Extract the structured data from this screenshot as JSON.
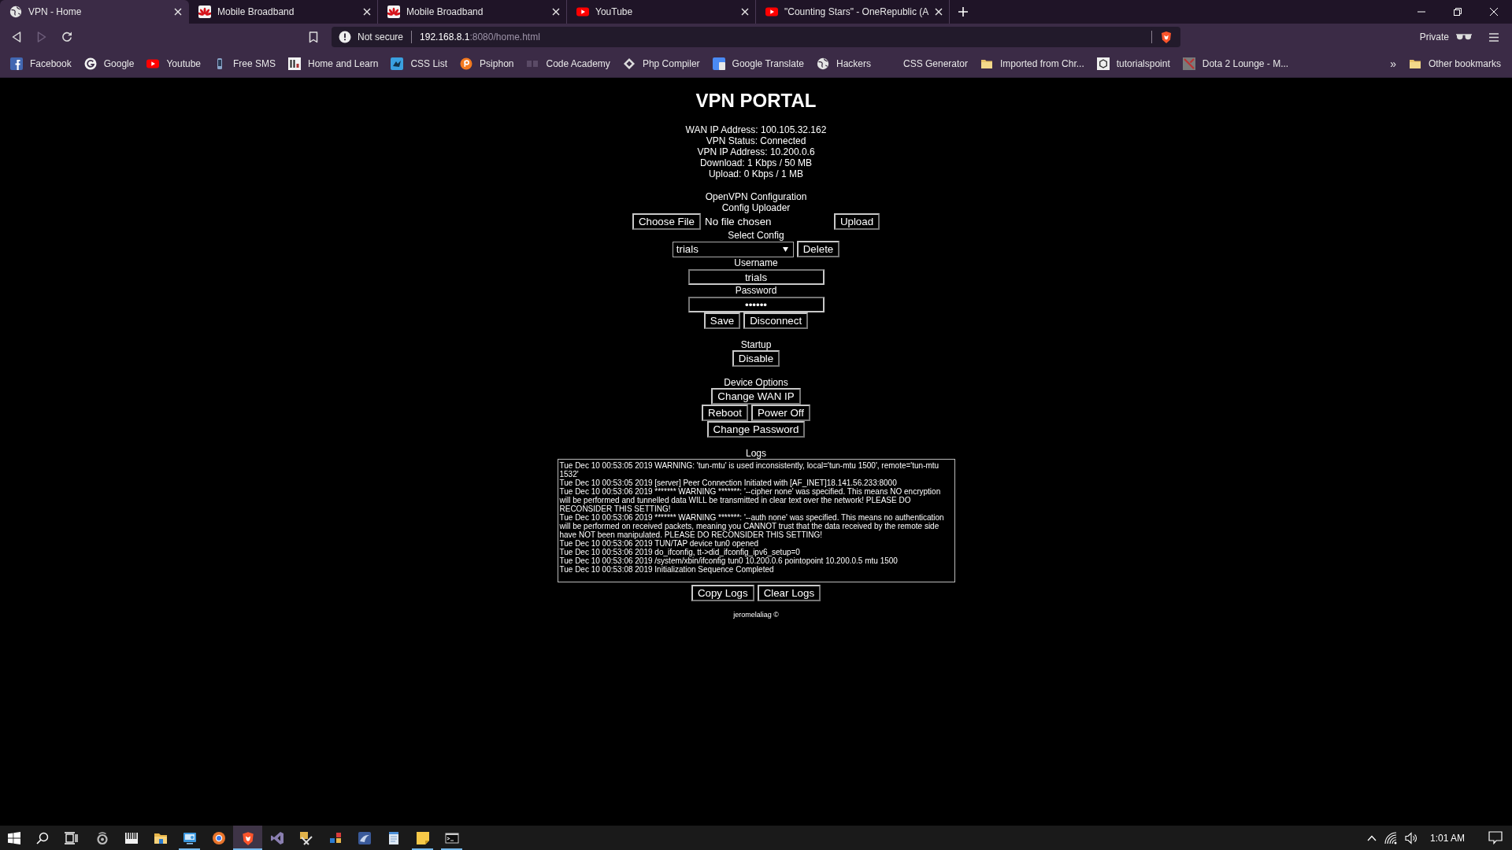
{
  "browser": {
    "tabs": [
      {
        "title": "VPN - Home",
        "selected": true
      },
      {
        "title": "Mobile Broadband",
        "selected": false
      },
      {
        "title": "Mobile Broadband",
        "selected": false
      },
      {
        "title": "YouTube",
        "selected": false
      },
      {
        "title": "\"Counting Stars\" - OneRepublic (A",
        "selected": false
      }
    ],
    "navigation": {
      "back_disabled": false,
      "forward_disabled": true
    },
    "address": {
      "security": "Not secure",
      "host": "192.168.8.1",
      "path": ":8080/home.html"
    },
    "profile": "Private",
    "bookmarks": [
      {
        "label": "Facebook"
      },
      {
        "label": "Google"
      },
      {
        "label": "Youtube"
      },
      {
        "label": "Free SMS"
      },
      {
        "label": "Home and Learn"
      },
      {
        "label": "CSS List"
      },
      {
        "label": "Psiphon"
      },
      {
        "label": "Code Academy"
      },
      {
        "label": "Php Compiler"
      },
      {
        "label": "Google Translate"
      },
      {
        "label": "Hackers"
      },
      {
        "label": "CSS Generator"
      },
      {
        "label": "Imported from Chr..."
      },
      {
        "label": "tutorialspoint"
      },
      {
        "label": "Dota 2 Lounge - M..."
      }
    ],
    "bookmarks_overflow": "»",
    "other_bookmarks": "Other bookmarks"
  },
  "page": {
    "title": "VPN PORTAL",
    "status_lines": [
      "WAN IP Address: 100.105.32.162",
      "VPN Status: Connected",
      "VPN IP Address: 10.200.0.6",
      "Download: 1 Kbps / 50 MB",
      "Upload: 0 Kbps / 1 MB"
    ],
    "config": {
      "heading": "OpenVPN Configuration",
      "subheading": "Config Uploader",
      "choose_button": "Choose File",
      "file_status": "No file chosen",
      "upload_button": "Upload",
      "select_label": "Select Config",
      "selected_config": "trials",
      "delete_button": "Delete",
      "username_label": "Username",
      "username": "trials",
      "password_label": "Password",
      "password": "••••••",
      "buttons": [
        "Save",
        "Disconnect"
      ]
    },
    "startup": {
      "label": "Startup",
      "button": "Disable"
    },
    "device_options": {
      "label": "Device Options",
      "rows": [
        [
          "Change WAN IP"
        ],
        [
          "Reboot",
          "Power Off"
        ],
        [
          "Change Password"
        ]
      ]
    },
    "logs": {
      "label": "Logs",
      "lines": [
        "Tue Dec 10 00:53:05 2019 WARNING: 'tun-mtu' is used inconsistently, local='tun-mtu 1500', remote='tun-mtu 1532'",
        "Tue Dec 10 00:53:05 2019 [server] Peer Connection Initiated with [AF_INET]18.141.56.233:8000",
        "Tue Dec 10 00:53:06 2019 ******* WARNING *******: '--cipher none' was specified. This means NO encryption will be performed and tunnelled data WILL be transmitted in clear text over the network! PLEASE DO RECONSIDER THIS SETTING!",
        "Tue Dec 10 00:53:06 2019 ******* WARNING *******: '--auth none' was specified. This means no authentication will be performed on received packets, meaning you CANNOT trust that the data received by the remote side have NOT been manipulated. PLEASE DO RECONSIDER THIS SETTING!",
        "Tue Dec 10 00:53:06 2019 TUN/TAP device tun0 opened",
        "Tue Dec 10 00:53:06 2019 do_ifconfig, tt->did_ifconfig_ipv6_setup=0",
        "Tue Dec 10 00:53:06 2019 /system/xbin/ifconfig tun0 10.200.0.6 pointopoint 10.200.0.5 mtu 1500",
        "Tue Dec 10 00:53:08 2019 Initialization Sequence Completed"
      ],
      "buttons": [
        "Copy Logs",
        "Clear Logs"
      ]
    },
    "footer": "jeromelaliag ©"
  },
  "taskbar": {
    "apps": [
      {
        "running": false,
        "focused": false
      },
      {
        "running": false,
        "focused": false
      },
      {
        "running": false,
        "focused": false
      },
      {
        "running": true,
        "focused": false
      },
      {
        "running": false,
        "focused": false
      },
      {
        "running": true,
        "focused": true
      },
      {
        "running": false,
        "focused": false
      },
      {
        "running": false,
        "focused": false
      },
      {
        "running": false,
        "focused": false
      },
      {
        "running": false,
        "focused": false
      },
      {
        "running": false,
        "focused": false
      },
      {
        "running": true,
        "focused": false
      },
      {
        "running": true,
        "focused": false
      }
    ],
    "time": "1:01 AM"
  }
}
